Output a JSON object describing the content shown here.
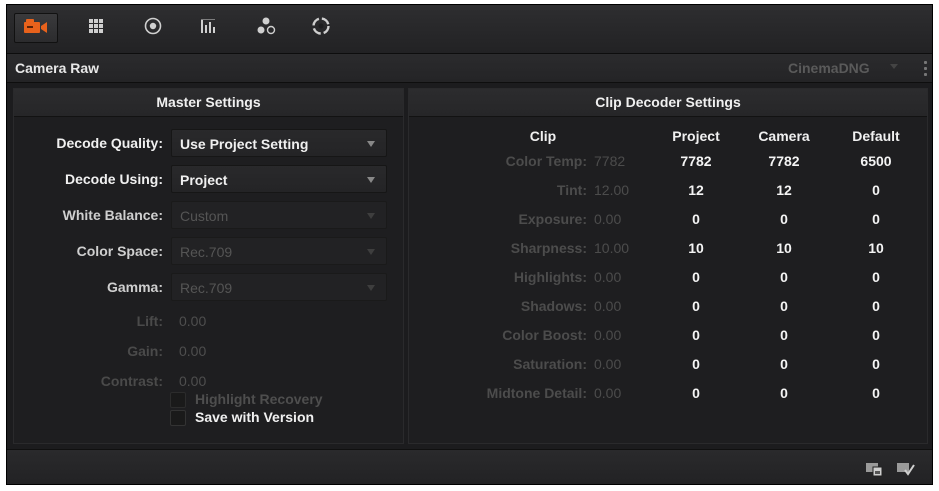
{
  "toolbar": {
    "tabs": [
      {
        "icon": "camera-icon",
        "active": true
      },
      {
        "icon": "grid-icon"
      },
      {
        "icon": "target-icon"
      },
      {
        "icon": "bars-icon"
      },
      {
        "icon": "nodes-icon"
      },
      {
        "icon": "aperture-icon"
      }
    ],
    "accent": "#e8621c"
  },
  "header": {
    "title": "Camera Raw",
    "format_select": "CinemaDNG"
  },
  "master": {
    "title": "Master Settings",
    "decode_quality": {
      "label": "Decode Quality:",
      "value": "Use Project Setting"
    },
    "decode_using": {
      "label": "Decode Using:",
      "value": "Project"
    },
    "white_balance": {
      "label": "White Balance:",
      "value": "Custom"
    },
    "color_space": {
      "label": "Color Space:",
      "value": "Rec.709"
    },
    "gamma": {
      "label": "Gamma:",
      "value": "Rec.709"
    },
    "lift": {
      "label": "Lift:",
      "value": "0.00"
    },
    "gain": {
      "label": "Gain:",
      "value": "0.00"
    },
    "contrast": {
      "label": "Contrast:",
      "value": "0.00"
    },
    "highlight_recovery": "Highlight Recovery",
    "save_with_version": "Save with Version"
  },
  "clip_decoder": {
    "title": "Clip Decoder Settings",
    "headers": {
      "clip": "Clip",
      "project": "Project",
      "camera": "Camera",
      "default": "Default"
    },
    "rows": [
      {
        "label": "Color Temp:",
        "clip": "7782",
        "project": "7782",
        "camera": "7782",
        "default": "6500"
      },
      {
        "label": "Tint:",
        "clip": "12.00",
        "project": "12",
        "camera": "12",
        "default": "0"
      },
      {
        "label": "Exposure:",
        "clip": "0.00",
        "project": "0",
        "camera": "0",
        "default": "0"
      },
      {
        "label": "Sharpness:",
        "clip": "10.00",
        "project": "10",
        "camera": "10",
        "default": "10"
      },
      {
        "label": "Highlights:",
        "clip": "0.00",
        "project": "0",
        "camera": "0",
        "default": "0"
      },
      {
        "label": "Shadows:",
        "clip": "0.00",
        "project": "0",
        "camera": "0",
        "default": "0"
      },
      {
        "label": "Color Boost:",
        "clip": "0.00",
        "project": "0",
        "camera": "0",
        "default": "0"
      },
      {
        "label": "Saturation:",
        "clip": "0.00",
        "project": "0",
        "camera": "0",
        "default": "0"
      },
      {
        "label": "Midtone Detail:",
        "clip": "0.00",
        "project": "0",
        "camera": "0",
        "default": "0"
      }
    ]
  },
  "footer": {
    "icons": [
      "copy-to-clip-icon",
      "apply-check-icon"
    ]
  }
}
